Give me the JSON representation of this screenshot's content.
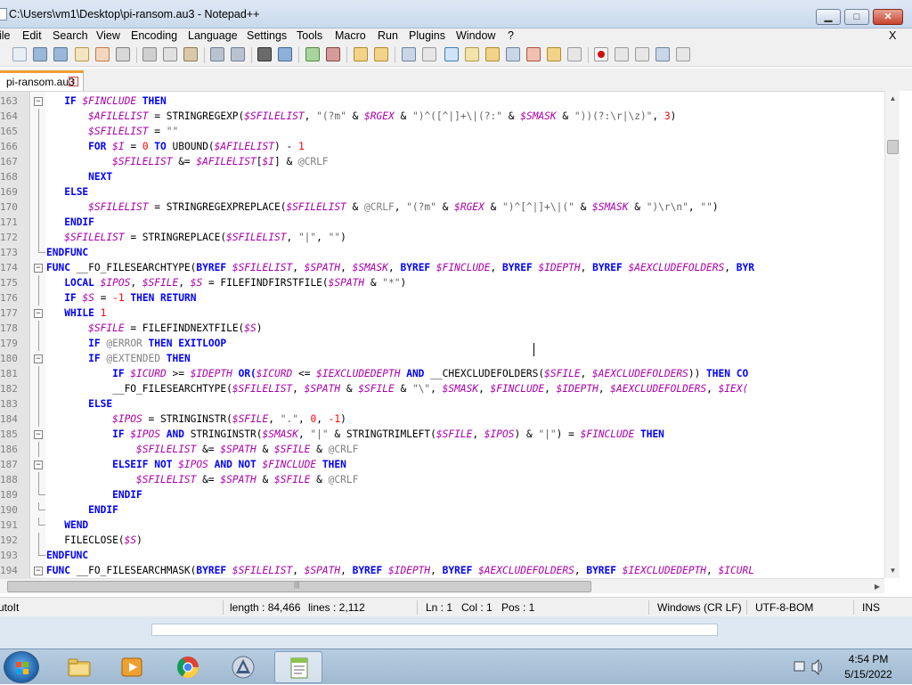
{
  "window": {
    "title": "C:\\Users\\vm1\\Desktop\\pi-ransom.au3 - Notepad++",
    "min_glyph": "▁",
    "max_glyph": "□",
    "close_glyph": "✕"
  },
  "menu": {
    "items": [
      "ile",
      "Edit",
      "Search",
      "View",
      "Encoding",
      "Language",
      "Settings",
      "Tools",
      "Macro",
      "Run",
      "Plugins",
      "Window",
      "?"
    ],
    "close": "X"
  },
  "tab": {
    "label": "pi-ransom.au3",
    "close_glyph": "x"
  },
  "editor": {
    "lines": [
      {
        "n": "63",
        "fold": "minus",
        "tokens": [
          [
            "   ",
            ""
          ],
          [
            "IF ",
            "kw"
          ],
          [
            "$FINCLUDE",
            "vr"
          ],
          [
            " THEN",
            "kw"
          ]
        ]
      },
      {
        "n": "64",
        "fold": "line",
        "tokens": [
          [
            "       ",
            ""
          ],
          [
            "$AFILELIST",
            "vr"
          ],
          [
            " = STRINGREGEXP(",
            "fn"
          ],
          [
            "$SFILELIST",
            "vr"
          ],
          [
            ", ",
            "op"
          ],
          [
            "\"(?m\"",
            "st"
          ],
          [
            " & ",
            "op"
          ],
          [
            "$RGEX",
            "vr"
          ],
          [
            " & ",
            "op"
          ],
          [
            "\")^([^|]+\\|(?:\"",
            "st"
          ],
          [
            " & ",
            "op"
          ],
          [
            "$SMASK",
            "vr"
          ],
          [
            " & ",
            "op"
          ],
          [
            "\"))(?:\\r|\\z)\"",
            "st"
          ],
          [
            ", ",
            "op"
          ],
          [
            "3",
            "nu"
          ],
          [
            ")",
            "op"
          ]
        ]
      },
      {
        "n": "65",
        "fold": "line",
        "tokens": [
          [
            "       ",
            ""
          ],
          [
            "$SFILELIST",
            "vr"
          ],
          [
            " = ",
            "op"
          ],
          [
            "\"\"",
            "st"
          ]
        ]
      },
      {
        "n": "66",
        "fold": "line",
        "tokens": [
          [
            "       ",
            ""
          ],
          [
            "FOR ",
            "kw"
          ],
          [
            "$I",
            "vr"
          ],
          [
            " = ",
            "op"
          ],
          [
            "0",
            "nu"
          ],
          [
            " TO ",
            "kw"
          ],
          [
            "UBOUND(",
            "fn"
          ],
          [
            "$AFILELIST",
            "vr"
          ],
          [
            ") - ",
            "op"
          ],
          [
            "1",
            "nu"
          ]
        ]
      },
      {
        "n": "67",
        "fold": "line",
        "tokens": [
          [
            "           ",
            ""
          ],
          [
            "$SFILELIST",
            "vr"
          ],
          [
            " &= ",
            "op"
          ],
          [
            "$AFILELIST",
            "vr"
          ],
          [
            "[",
            "op"
          ],
          [
            "$I",
            "vr"
          ],
          [
            "] & ",
            "op"
          ],
          [
            "@CRLF",
            "mc"
          ]
        ]
      },
      {
        "n": "68",
        "fold": "line",
        "tokens": [
          [
            "       ",
            ""
          ],
          [
            "NEXT",
            "kw"
          ]
        ]
      },
      {
        "n": "69",
        "fold": "line",
        "tokens": [
          [
            "   ",
            ""
          ],
          [
            "ELSE",
            "kw"
          ]
        ]
      },
      {
        "n": "70",
        "fold": "line",
        "tokens": [
          [
            "       ",
            ""
          ],
          [
            "$SFILELIST",
            "vr"
          ],
          [
            " = STRINGREGEXPREPLACE(",
            "fn"
          ],
          [
            "$SFILELIST",
            "vr"
          ],
          [
            " & ",
            "op"
          ],
          [
            "@CRLF",
            "mc"
          ],
          [
            ", ",
            "op"
          ],
          [
            "\"(?m\"",
            "st"
          ],
          [
            " & ",
            "op"
          ],
          [
            "$RGEX",
            "vr"
          ],
          [
            " & ",
            "op"
          ],
          [
            "\")^[^|]+\\|(\"",
            "st"
          ],
          [
            " & ",
            "op"
          ],
          [
            "$SMASK",
            "vr"
          ],
          [
            " & ",
            "op"
          ],
          [
            "\")\\r\\n\"",
            "st"
          ],
          [
            ", ",
            "op"
          ],
          [
            "\"\"",
            "st"
          ],
          [
            ")",
            "op"
          ]
        ]
      },
      {
        "n": "71",
        "fold": "line",
        "tokens": [
          [
            "   ",
            ""
          ],
          [
            "ENDIF",
            "kw"
          ]
        ]
      },
      {
        "n": "72",
        "fold": "line",
        "tokens": [
          [
            "   ",
            ""
          ],
          [
            "$SFILELIST",
            "vr"
          ],
          [
            " = STRINGREPLACE(",
            "fn"
          ],
          [
            "$SFILELIST",
            "vr"
          ],
          [
            ", ",
            "op"
          ],
          [
            "\"|\"",
            "st"
          ],
          [
            ", ",
            "op"
          ],
          [
            "\"\"",
            "st"
          ],
          [
            ")",
            "op"
          ]
        ]
      },
      {
        "n": "73",
        "fold": "end",
        "tokens": [
          [
            "",
            ""
          ],
          [
            "ENDFUNC",
            "kw"
          ]
        ]
      },
      {
        "n": "74",
        "fold": "minus",
        "tokens": [
          [
            "",
            ""
          ],
          [
            "FUNC ",
            "kw"
          ],
          [
            "__FO_FILESEARCHTYPE(",
            "fn"
          ],
          [
            "BYREF ",
            "kw"
          ],
          [
            "$SFILELIST",
            "vr"
          ],
          [
            ", ",
            "op"
          ],
          [
            "$SPATH",
            "vr"
          ],
          [
            ", ",
            "op"
          ],
          [
            "$SMASK",
            "vr"
          ],
          [
            ", ",
            "op"
          ],
          [
            "BYREF ",
            "kw"
          ],
          [
            "$FINCLUDE",
            "vr"
          ],
          [
            ", ",
            "op"
          ],
          [
            "BYREF ",
            "kw"
          ],
          [
            "$IDEPTH",
            "vr"
          ],
          [
            ", ",
            "op"
          ],
          [
            "BYREF ",
            "kw"
          ],
          [
            "$AEXCLUDEFOLDERS",
            "vr"
          ],
          [
            ", ",
            "op"
          ],
          [
            "BYR",
            "kw"
          ]
        ]
      },
      {
        "n": "75",
        "fold": "line",
        "tokens": [
          [
            "   ",
            ""
          ],
          [
            "LOCAL ",
            "kw"
          ],
          [
            "$IPOS",
            "vr"
          ],
          [
            ", ",
            "op"
          ],
          [
            "$SFILE",
            "vr"
          ],
          [
            ", ",
            "op"
          ],
          [
            "$S",
            "vr"
          ],
          [
            " = FILEFINDFIRSTFILE(",
            "fn"
          ],
          [
            "$SPATH",
            "vr"
          ],
          [
            " & ",
            "op"
          ],
          [
            "\"*\"",
            "st"
          ],
          [
            ")",
            "op"
          ]
        ]
      },
      {
        "n": "76",
        "fold": "line",
        "tokens": [
          [
            "   ",
            ""
          ],
          [
            "IF ",
            "kw"
          ],
          [
            "$S",
            "vr"
          ],
          [
            " = ",
            "op"
          ],
          [
            "-1",
            "nu"
          ],
          [
            " THEN RETURN",
            "kw"
          ]
        ]
      },
      {
        "n": "77",
        "fold": "minus",
        "tokens": [
          [
            "   ",
            ""
          ],
          [
            "WHILE ",
            "kw"
          ],
          [
            "1",
            "nu"
          ]
        ]
      },
      {
        "n": "78",
        "fold": "line",
        "tokens": [
          [
            "       ",
            ""
          ],
          [
            "$SFILE",
            "vr"
          ],
          [
            " = FILEFINDNEXTFILE(",
            "fn"
          ],
          [
            "$S",
            "vr"
          ],
          [
            ")",
            "op"
          ]
        ]
      },
      {
        "n": "79",
        "fold": "line",
        "tokens": [
          [
            "       ",
            ""
          ],
          [
            "IF ",
            "kw"
          ],
          [
            "@ERROR",
            "mc"
          ],
          [
            " THEN EXITLOOP",
            "kw"
          ]
        ]
      },
      {
        "n": "80",
        "fold": "minus",
        "tokens": [
          [
            "       ",
            ""
          ],
          [
            "IF ",
            "kw"
          ],
          [
            "@EXTENDED",
            "mc"
          ],
          [
            " THEN",
            "kw"
          ]
        ]
      },
      {
        "n": "81",
        "fold": "line",
        "tokens": [
          [
            "           ",
            ""
          ],
          [
            "IF ",
            "kw"
          ],
          [
            "$ICURD",
            "vr"
          ],
          [
            " >= ",
            "op"
          ],
          [
            "$IDEPTH",
            "vr"
          ],
          [
            " OR(",
            "kw"
          ],
          [
            "$ICURD",
            "vr"
          ],
          [
            " <= ",
            "op"
          ],
          [
            "$IEXCLUDEDEPTH",
            "vr"
          ],
          [
            " AND ",
            "kw"
          ],
          [
            "__CHEXCLUDEFOLDERS(",
            "fn"
          ],
          [
            "$SFILE",
            "vr"
          ],
          [
            ", ",
            "op"
          ],
          [
            "$AEXCLUDEFOLDERS",
            "vr"
          ],
          [
            ")) ",
            "op"
          ],
          [
            "THEN CO",
            "kw"
          ]
        ]
      },
      {
        "n": "82",
        "fold": "line",
        "tokens": [
          [
            "           ",
            ""
          ],
          [
            "__FO_FILESEARCHTYPE(",
            "fn"
          ],
          [
            "$SFILELIST",
            "vr"
          ],
          [
            ", ",
            "op"
          ],
          [
            "$SPATH",
            "vr"
          ],
          [
            " & ",
            "op"
          ],
          [
            "$SFILE",
            "vr"
          ],
          [
            " & ",
            "op"
          ],
          [
            "\"\\\"",
            "st"
          ],
          [
            ", ",
            "op"
          ],
          [
            "$SMASK",
            "vr"
          ],
          [
            ", ",
            "op"
          ],
          [
            "$FINCLUDE",
            "vr"
          ],
          [
            ", ",
            "op"
          ],
          [
            "$IDEPTH",
            "vr"
          ],
          [
            ", ",
            "op"
          ],
          [
            "$AEXCLUDEFOLDERS",
            "vr"
          ],
          [
            ", ",
            "op"
          ],
          [
            "$IEX(",
            "vr"
          ]
        ]
      },
      {
        "n": "83",
        "fold": "line",
        "tokens": [
          [
            "       ",
            ""
          ],
          [
            "ELSE",
            "kw"
          ]
        ]
      },
      {
        "n": "84",
        "fold": "line",
        "tokens": [
          [
            "           ",
            ""
          ],
          [
            "$IPOS",
            "vr"
          ],
          [
            " = STRINGINSTR(",
            "fn"
          ],
          [
            "$SFILE",
            "vr"
          ],
          [
            ", ",
            "op"
          ],
          [
            "\".\"",
            "st"
          ],
          [
            ", ",
            "op"
          ],
          [
            "0",
            "nu"
          ],
          [
            ", ",
            "op"
          ],
          [
            "-1",
            "nu"
          ],
          [
            ")",
            "op"
          ]
        ]
      },
      {
        "n": "85",
        "fold": "minus",
        "tokens": [
          [
            "           ",
            ""
          ],
          [
            "IF ",
            "kw"
          ],
          [
            "$IPOS",
            "vr"
          ],
          [
            " AND ",
            "kw"
          ],
          [
            "STRINGINSTR(",
            "fn"
          ],
          [
            "$SMASK",
            "vr"
          ],
          [
            ", ",
            "op"
          ],
          [
            "\"|\"",
            "st"
          ],
          [
            " & STRINGTRIMLEFT(",
            "fn"
          ],
          [
            "$SFILE",
            "vr"
          ],
          [
            ", ",
            "op"
          ],
          [
            "$IPOS",
            "vr"
          ],
          [
            ") & ",
            "op"
          ],
          [
            "\"|\"",
            "st"
          ],
          [
            ") = ",
            "op"
          ],
          [
            "$FINCLUDE",
            "vr"
          ],
          [
            " THEN",
            "kw"
          ]
        ]
      },
      {
        "n": "86",
        "fold": "line",
        "tokens": [
          [
            "               ",
            ""
          ],
          [
            "$SFILELIST",
            "vr"
          ],
          [
            " &= ",
            "op"
          ],
          [
            "$SPATH",
            "vr"
          ],
          [
            " & ",
            "op"
          ],
          [
            "$SFILE",
            "vr"
          ],
          [
            " & ",
            "op"
          ],
          [
            "@CRLF",
            "mc"
          ]
        ]
      },
      {
        "n": "87",
        "fold": "minus",
        "tokens": [
          [
            "           ",
            ""
          ],
          [
            "ELSEIF NOT ",
            "kw"
          ],
          [
            "$IPOS",
            "vr"
          ],
          [
            " AND NOT ",
            "kw"
          ],
          [
            "$FINCLUDE",
            "vr"
          ],
          [
            " THEN",
            "kw"
          ]
        ]
      },
      {
        "n": "88",
        "fold": "line",
        "tokens": [
          [
            "               ",
            ""
          ],
          [
            "$SFILELIST",
            "vr"
          ],
          [
            " &= ",
            "op"
          ],
          [
            "$SPATH",
            "vr"
          ],
          [
            " & ",
            "op"
          ],
          [
            "$SFILE",
            "vr"
          ],
          [
            " & ",
            "op"
          ],
          [
            "@CRLF",
            "mc"
          ]
        ]
      },
      {
        "n": "89",
        "fold": "end",
        "tokens": [
          [
            "           ",
            ""
          ],
          [
            "ENDIF",
            "kw"
          ]
        ]
      },
      {
        "n": "90",
        "fold": "end",
        "tokens": [
          [
            "       ",
            ""
          ],
          [
            "ENDIF",
            "kw"
          ]
        ]
      },
      {
        "n": "91",
        "fold": "end",
        "tokens": [
          [
            "   ",
            ""
          ],
          [
            "WEND",
            "kw"
          ]
        ]
      },
      {
        "n": "92",
        "fold": "line",
        "tokens": [
          [
            "   ",
            ""
          ],
          [
            "FILECLOSE(",
            "fn"
          ],
          [
            "$S",
            "vr"
          ],
          [
            ")",
            "op"
          ]
        ]
      },
      {
        "n": "93",
        "fold": "end",
        "tokens": [
          [
            "",
            ""
          ],
          [
            "ENDFUNC",
            "kw"
          ]
        ]
      },
      {
        "n": "94",
        "fold": "minus",
        "tokens": [
          [
            "",
            ""
          ],
          [
            "FUNC ",
            "kw"
          ],
          [
            "__FO_FILESEARCHMASK(",
            "fn"
          ],
          [
            "BYREF ",
            "kw"
          ],
          [
            "$SFILELIST",
            "vr"
          ],
          [
            ", ",
            "op"
          ],
          [
            "$SPATH",
            "vr"
          ],
          [
            ", ",
            "op"
          ],
          [
            "BYREF ",
            "kw"
          ],
          [
            "$IDEPTH",
            "vr"
          ],
          [
            ", ",
            "op"
          ],
          [
            "BYREF ",
            "kw"
          ],
          [
            "$AEXCLUDEFOLDERS",
            "vr"
          ],
          [
            ", ",
            "op"
          ],
          [
            "BYREF ",
            "kw"
          ],
          [
            "$IEXCLUDEDEPTH",
            "vr"
          ],
          [
            ", ",
            "op"
          ],
          [
            "$ICURL",
            "vr"
          ]
        ]
      }
    ],
    "line_number_prefix": ".1"
  },
  "status": {
    "language": "utoIt",
    "length": "length : 84,466",
    "lines": "lines : 2,112",
    "ln": "Ln : 1",
    "col": "Col : 1",
    "pos": "Pos : 1",
    "eol": "Windows (CR LF)",
    "encoding": "UTF-8-BOM",
    "mode": "INS"
  },
  "taskbar": {
    "time": "4:54 PM",
    "date": "5/15/2022"
  },
  "colors": {
    "keyword": "#0000ff",
    "variable": "#aa00aa",
    "string": "#666666",
    "number": "#ff0000",
    "macro": "#808080",
    "tab_accent": "#f39c33"
  }
}
